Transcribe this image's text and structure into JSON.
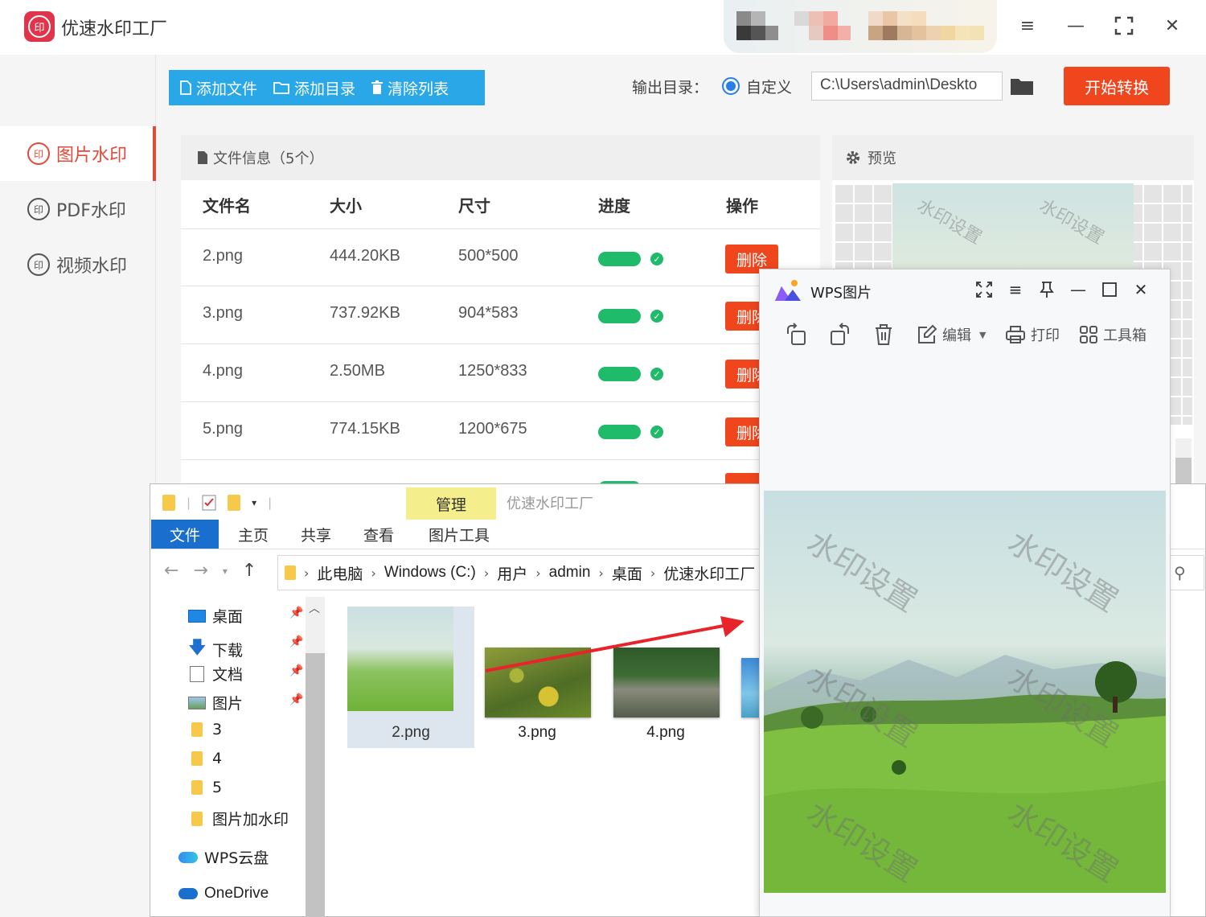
{
  "app": {
    "title": "优速水印工厂",
    "logo_text": "印",
    "window_controls": [
      "menu-icon",
      "minimize-icon",
      "fullscreen-icon",
      "close-icon"
    ]
  },
  "sidebar": {
    "items": [
      {
        "label": "图片水印",
        "active": true
      },
      {
        "label": "PDF水印",
        "active": false
      },
      {
        "label": "视频水印",
        "active": false
      }
    ],
    "icon_text": "印"
  },
  "toolbar": {
    "add_file": "添加文件",
    "add_dir": "添加目录",
    "clear_list": "清除列表",
    "output_label": "输出目录：",
    "radio_label": "自定义",
    "output_path": "C:\\Users\\admin\\Deskto",
    "start_button": "开始转换"
  },
  "file_panel": {
    "header": "文件信息（5个）",
    "columns": [
      "文件名",
      "大小",
      "尺寸",
      "进度",
      "操作"
    ],
    "rows": [
      {
        "name": "2.png",
        "size": "444.20KB",
        "dims": "500*500",
        "action": "删除"
      },
      {
        "name": "3.png",
        "size": "737.92KB",
        "dims": "904*583",
        "action": "删除"
      },
      {
        "name": "4.png",
        "size": "2.50MB",
        "dims": "1250*833",
        "action": "删除"
      },
      {
        "name": "5.png",
        "size": "774.15KB",
        "dims": "1200*675",
        "action": "删除"
      }
    ]
  },
  "preview": {
    "header": "预览",
    "watermark": "水印设置"
  },
  "explorer": {
    "manage_tab": "管理",
    "title": "优速水印工厂",
    "ribbon_tabs": [
      "文件",
      "主页",
      "共享",
      "查看",
      "图片工具"
    ],
    "breadcrumb": [
      "此电脑",
      "Windows (C:)",
      "用户",
      "admin",
      "桌面",
      "优速水印工厂"
    ],
    "tree": [
      {
        "label": "桌面",
        "icon": "desktop-icon",
        "pinned": true
      },
      {
        "label": "下载",
        "icon": "download-icon",
        "pinned": true
      },
      {
        "label": "文档",
        "icon": "document-icon",
        "pinned": true
      },
      {
        "label": "图片",
        "icon": "pictures-icon",
        "pinned": true
      },
      {
        "label": "3",
        "icon": "folder-icon",
        "pinned": false
      },
      {
        "label": "4",
        "icon": "folder-icon",
        "pinned": false
      },
      {
        "label": "5",
        "icon": "folder-icon",
        "pinned": false
      },
      {
        "label": "图片加水印",
        "icon": "folder-icon",
        "pinned": false
      },
      {
        "label": "WPS云盘",
        "icon": "cloud-icon",
        "pinned": false
      },
      {
        "label": "OneDrive",
        "icon": "onedrive-icon",
        "pinned": false
      }
    ],
    "files": [
      "2.png",
      "3.png",
      "4.png"
    ]
  },
  "wps": {
    "title": "WPS图片",
    "tools": {
      "edit": "编辑",
      "print": "打印",
      "toolbox": "工具箱"
    },
    "watermark": "水印设置"
  },
  "colors": {
    "accent_blue": "#2aa7e6",
    "start_orange": "#f0461e",
    "progress_green": "#1fbb6b",
    "active_red": "#e24a3a",
    "explorer_blue": "#1a6fce",
    "manage_yellow": "#f4ee8c"
  }
}
